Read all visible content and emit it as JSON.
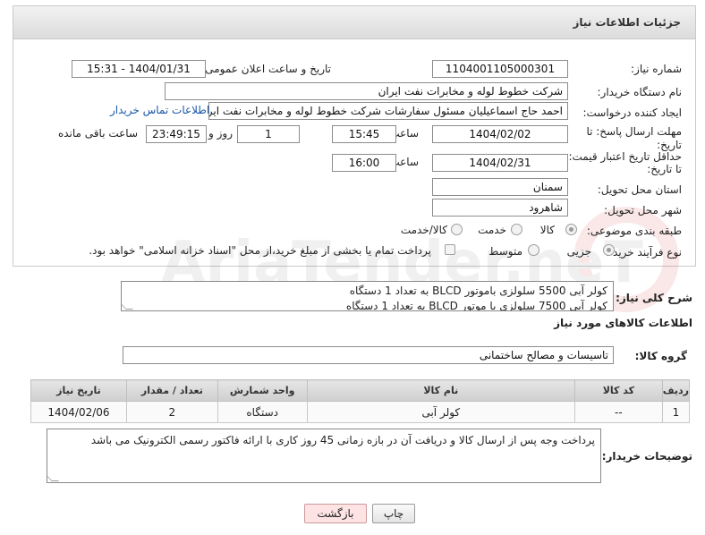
{
  "header": {
    "title": "جزئیات اطلاعات نیاز"
  },
  "form": {
    "need_number_label": "شماره نیاز:",
    "need_number": "1104001105000301",
    "announce_label": "تاریخ و ساعت اعلان عمومی:",
    "announce_value": "1404/01/31 - 15:31",
    "buyer_org_label": "نام دستگاه خریدار:",
    "buyer_org": "شرکت خطوط لوله و مخابرات نفت ایران",
    "creator_label": "ایجاد کننده درخواست:",
    "creator": "احمد  حاج اسماعیلیان مسئول سفارشات  شرکت خطوط لوله و مخابرات نفت ایر",
    "contact_link": "اطلاعات تماس خریدار",
    "deadline_label_1": "مهلت ارسال پاسخ: تا",
    "deadline_label_2": "تاریخ:",
    "deadline_date": "1404/02/02",
    "time_label": "ساعت",
    "deadline_time": "15:45",
    "days_value": "1",
    "days_label": "روز و",
    "remaining_time": "23:49:15",
    "remaining_label": "ساعت باقی مانده",
    "min_price_label_1": "حداقل تاریخ اعتبار قیمت:",
    "min_price_label_2": "تا تاریخ:",
    "min_price_date": "1404/02/31",
    "min_price_time": "16:00",
    "province_label": "استان محل تحویل:",
    "province": "سمنان",
    "city_label": "شهر محل تحویل:",
    "city": "شاهرود",
    "category_label": "طبقه بندی موضوعی:",
    "category_options": [
      "کالا",
      "خدمت",
      "کالا/خدمت"
    ],
    "process_label": "نوع فرآیند خرید :",
    "process_options": [
      "جزیی",
      "متوسط"
    ],
    "payment_note": "پرداخت تمام یا بخشی از مبلغ خرید،از محل \"اسناد خزانه اسلامی\" خواهد بود."
  },
  "description": {
    "label": "شرح کلی نیاز:",
    "line1": "کولر آبی 5500 سلولزی باموتور BLCD به تعداد 1 دستگاه",
    "line2": "کولر آبی 7500 سلولزی با موتور BLCD به تعداد 1 دستگاه"
  },
  "goods": {
    "section_title": "اطلاعات کالاهای مورد نیاز",
    "group_label": "گروه کالا:",
    "group_value": "تاسیسات و مصالح ساختمانی",
    "columns": [
      "ردیف",
      "کد کالا",
      "نام کالا",
      "واحد شمارش",
      "تعداد / مقدار",
      "تاریخ نیاز"
    ],
    "rows": [
      {
        "row": "1",
        "code": "--",
        "name": "کولر آبی",
        "unit": "دستگاه",
        "qty": "2",
        "date": "1404/02/06"
      }
    ]
  },
  "buyer_notes": {
    "label": "توضیحات خریدار:",
    "text": "پرداخت وجه پس از ارسال کالا و دریافت آن در بازه زمانی 45 روز کاری با ارائه فاکتور رسمی الکترونیک می باشد"
  },
  "buttons": {
    "print": "چاپ",
    "back": "بازگشت"
  },
  "watermark_text": "AriaTender.neT"
}
